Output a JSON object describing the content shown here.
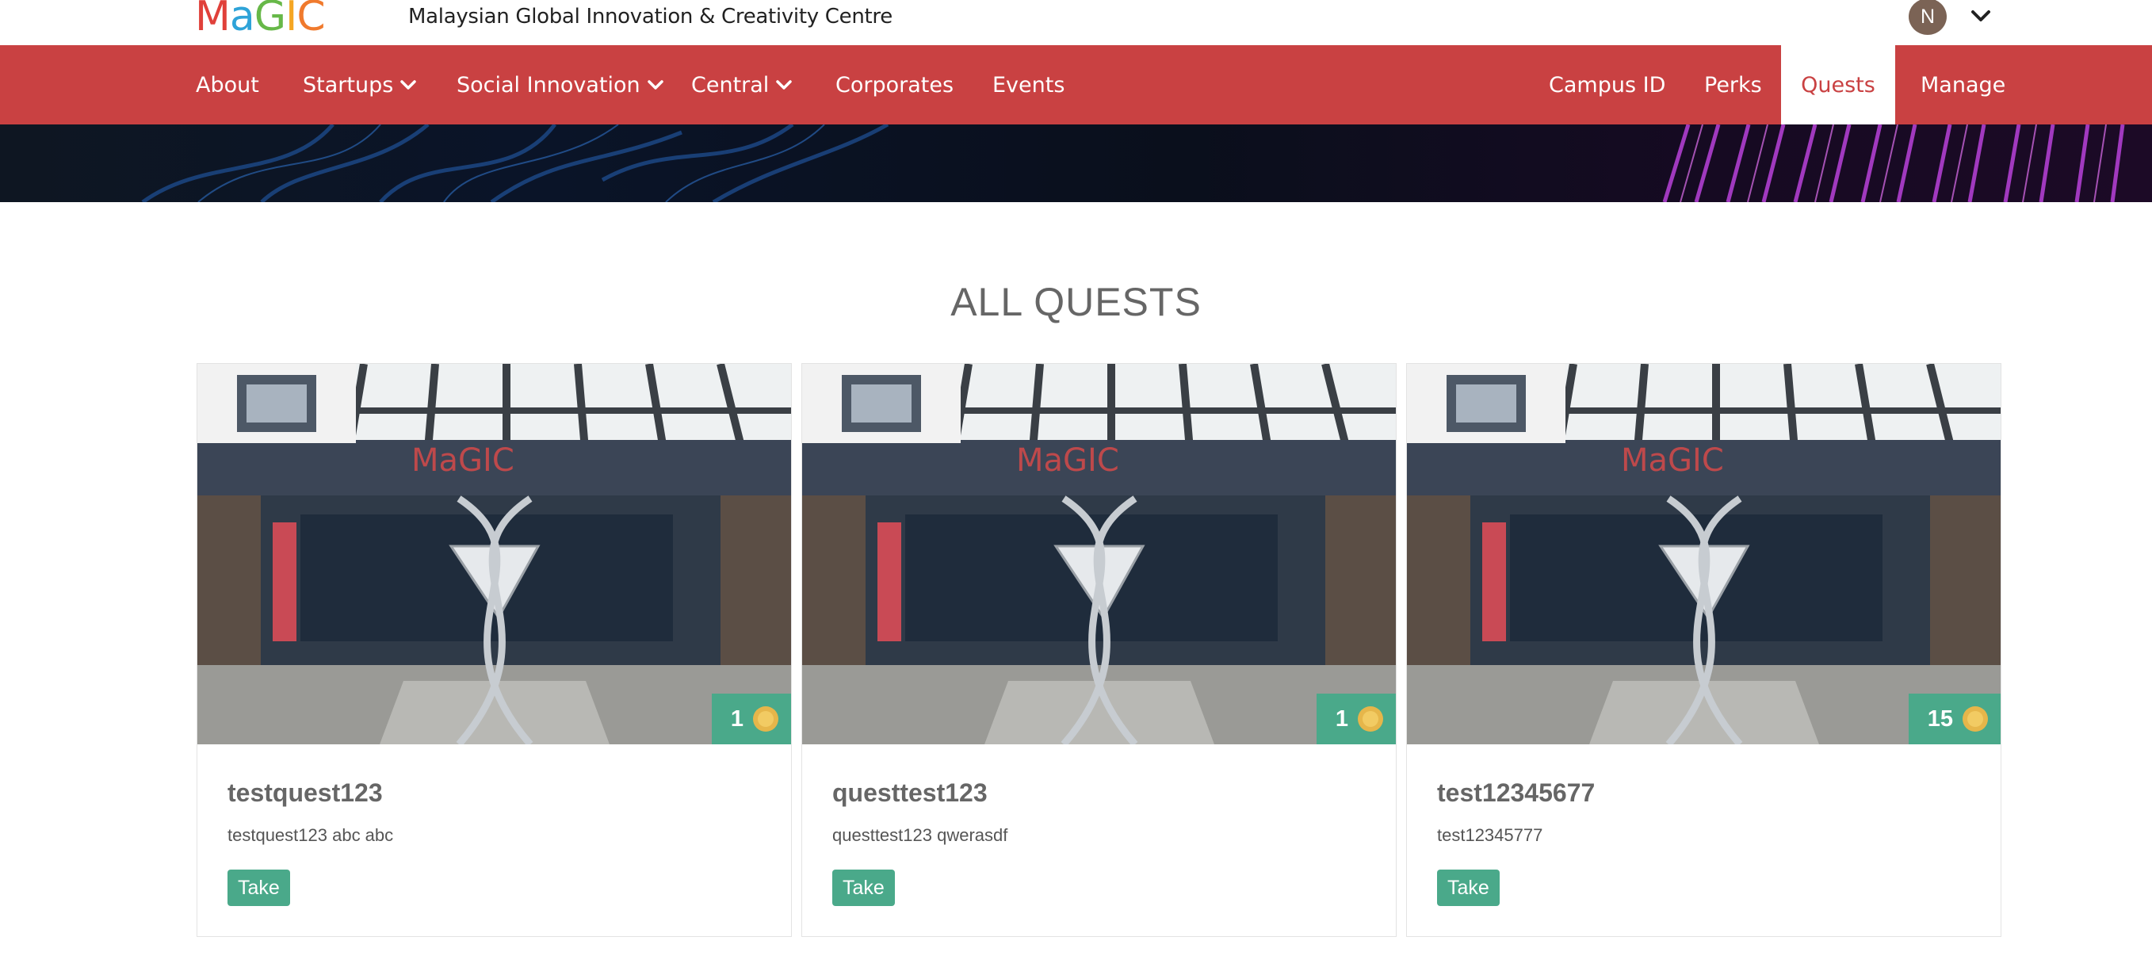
{
  "brand": {
    "logo_letters": [
      "M",
      "a",
      "G",
      "I",
      "C"
    ],
    "logo_colors": [
      "#e0403a",
      "#2ea3d8",
      "#67b848",
      "#f5a623",
      "#f07a2d"
    ],
    "org_name": "Malaysian Global Innovation & Creativity Centre"
  },
  "user": {
    "initial": "N",
    "avatar_color": "#7b6355",
    "menu_icon": "chevron-down-icon"
  },
  "nav": {
    "bg_color": "#c94142",
    "left_items": [
      {
        "label": "About",
        "has_dropdown": false
      },
      {
        "label": "Startups",
        "has_dropdown": true
      },
      {
        "label": "Social Innovation",
        "has_dropdown": true
      },
      {
        "label": "Central",
        "has_dropdown": true
      },
      {
        "label": "Corporates",
        "has_dropdown": false
      },
      {
        "label": "Events",
        "has_dropdown": false
      }
    ],
    "right_items": [
      {
        "label": "Campus ID",
        "active": false
      },
      {
        "label": "Perks",
        "active": false
      },
      {
        "label": "Quests",
        "active": true
      },
      {
        "label": "Manage",
        "active": false
      }
    ]
  },
  "page": {
    "title": "ALL QUESTS"
  },
  "quests": [
    {
      "title": "testquest123",
      "description": "testquest123 abc abc",
      "reward": "1",
      "reward_icon": "coin-icon",
      "action": "Take"
    },
    {
      "title": "questtest123",
      "description": "questtest123 qwerasdf",
      "reward": "1",
      "reward_icon": "coin-icon",
      "action": "Take"
    },
    {
      "title": "test12345677",
      "description": "test12345777",
      "reward": "15",
      "reward_icon": "coin-icon",
      "action": "Take"
    }
  ],
  "colors": {
    "accent_green": "#4aa98a",
    "coin": "#e6b64a"
  }
}
